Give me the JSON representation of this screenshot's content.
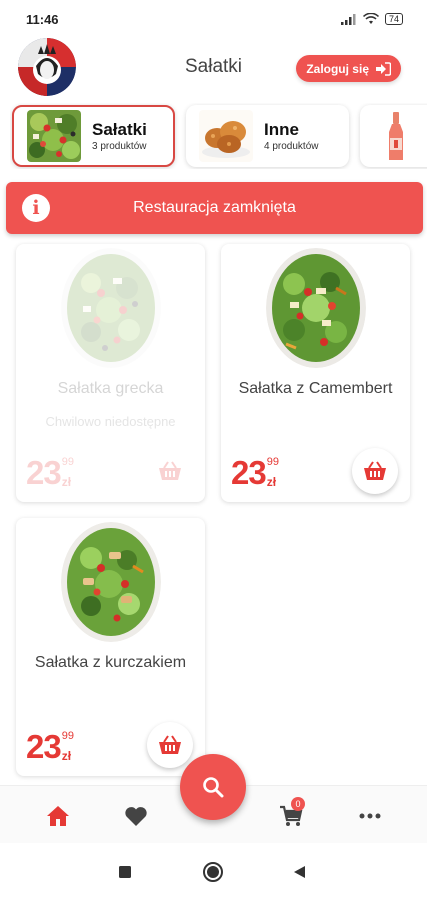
{
  "status_bar": {
    "time": "11:46",
    "battery": "74"
  },
  "header": {
    "title": "Sałatki",
    "login_label": "Zaloguj się"
  },
  "categories": [
    {
      "name": "Sałatki",
      "count": "3 produktów",
      "active": true
    },
    {
      "name": "Inne",
      "count": "4 produktów",
      "active": false
    }
  ],
  "banner": {
    "icon": "info-icon",
    "text": "Restauracja zamknięta"
  },
  "products": [
    {
      "name": "Sałatka grecka",
      "status": "Chwilowo niedostępne",
      "price_main": "23",
      "price_decimal": "99",
      "currency": "zł",
      "available": false
    },
    {
      "name": "Sałatka z Camembert",
      "status": "",
      "price_main": "23",
      "price_decimal": "99",
      "currency": "zł",
      "available": true
    },
    {
      "name": "Sałatka z kurczakiem",
      "status": "",
      "price_main": "23",
      "price_decimal": "99",
      "currency": "zł",
      "available": true
    }
  ],
  "bottom_nav": {
    "items": [
      "home-icon",
      "heart-icon",
      "search-icon",
      "cart-icon",
      "more-icon"
    ],
    "cart_badge": "0"
  },
  "colors": {
    "accent": "#ef5350",
    "price": "#e53935",
    "active_border": "#d84843"
  }
}
